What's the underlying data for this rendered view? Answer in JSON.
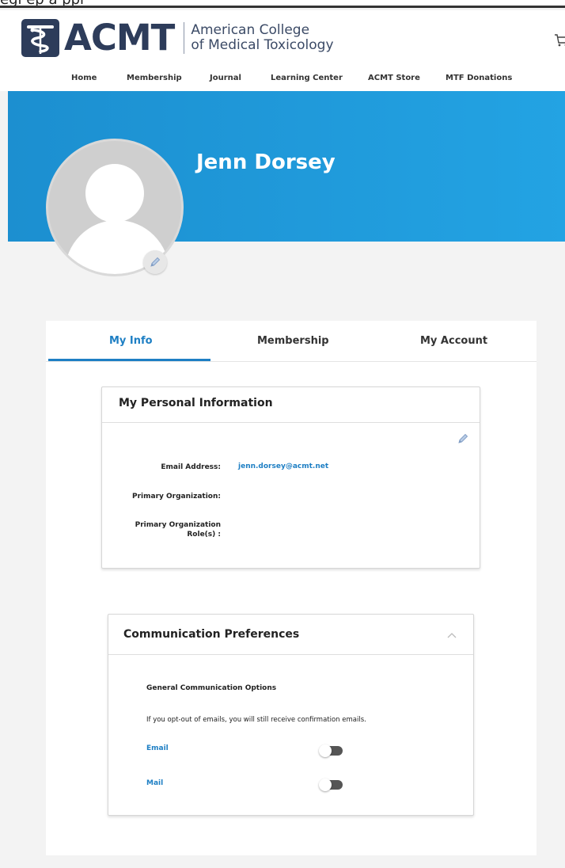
{
  "top_strip_text": "egi  ep  a            ppi ",
  "brand": {
    "logo_text": "ACMT",
    "subtitle_line1": "American College",
    "subtitle_line2": "of Medical Toxicology",
    "color": "#2d3c5a"
  },
  "nav": {
    "items": [
      "Home",
      "Membership",
      "Journal",
      "Learning Center",
      "ACMT Store",
      "MTF Donations"
    ]
  },
  "profile": {
    "name": "Jenn Dorsey"
  },
  "tabs": [
    "My Info",
    "Membership",
    "My Account"
  ],
  "active_tab": "My Info",
  "personal_info": {
    "title": "My Personal Information",
    "email_label": "Email Address:",
    "email_value": "jenn.dorsey@acmt.net",
    "org_label": "Primary Organization:",
    "role_label_line1": "Primary Organization",
    "role_label_line2": "Role(s) :"
  },
  "communication": {
    "title": "Communication Preferences",
    "subheading": "General Communication Options",
    "note": "If you opt-out of emails, you will still receive confirmation emails.",
    "options": [
      {
        "label": "Email",
        "enabled": false
      },
      {
        "label": "Mail",
        "enabled": false
      }
    ]
  },
  "colors": {
    "accent": "#1e7fc4",
    "banner": "#23a3e3"
  },
  "icons": {
    "logo": "caduceus-icon",
    "cart": "cart-icon",
    "edit": "pencil-icon",
    "collapse": "chevron-up-icon"
  }
}
